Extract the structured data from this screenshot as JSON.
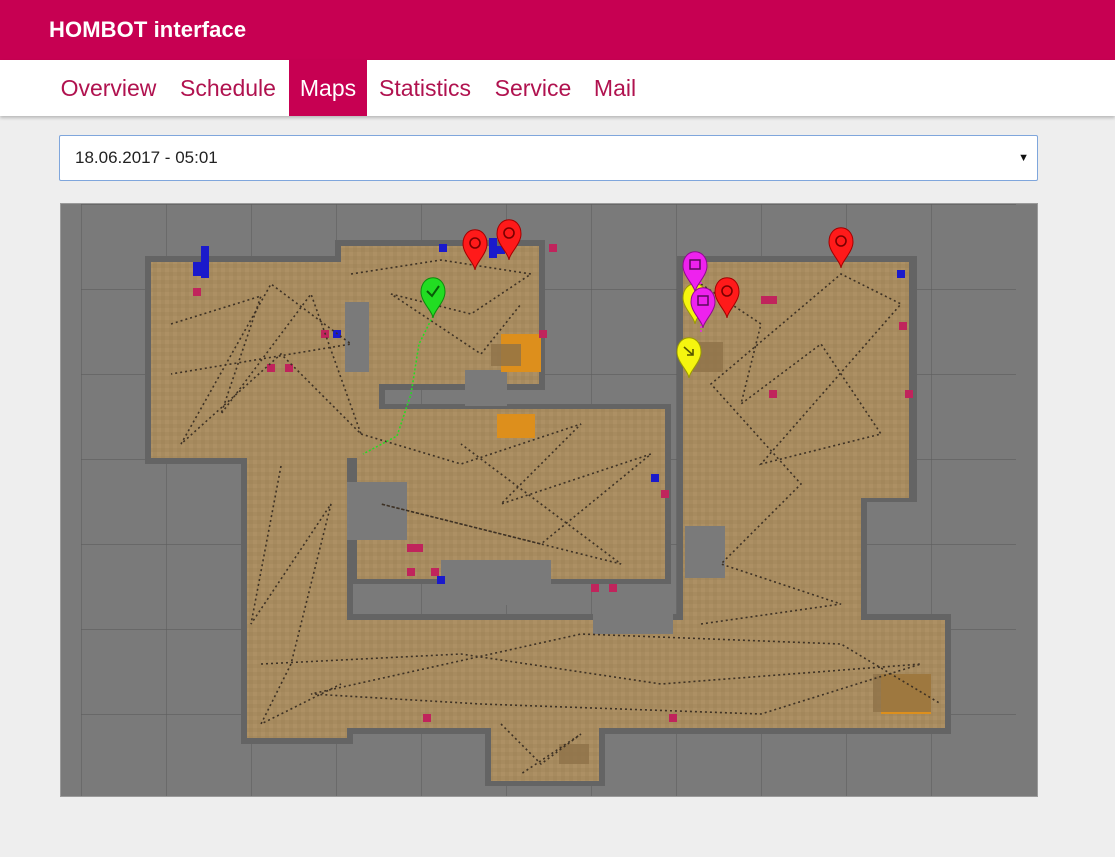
{
  "app": {
    "title": "HOMBOT interface"
  },
  "colors": {
    "brand": "#c70052",
    "floor": "#a78b5f",
    "wall": "#6a6a6a",
    "background": "#7a7a7a",
    "marker_red": "#ff1a1a",
    "marker_green": "#22dd22",
    "marker_magenta": "#ee22ee",
    "marker_yellow": "#f5f50f",
    "obstacle_blue": "#1a1acc",
    "obstacle_pink": "#c0245c",
    "carpet_orange": "#dd8f1c"
  },
  "nav": {
    "tabs": [
      {
        "label": "Overview",
        "active": false
      },
      {
        "label": "Schedule",
        "active": false
      },
      {
        "label": "Maps",
        "active": true
      },
      {
        "label": "Statistics",
        "active": false
      },
      {
        "label": "Service",
        "active": false
      },
      {
        "label": "Mail",
        "active": false
      }
    ]
  },
  "map_select": {
    "selected": "18.06.2017 - 05:01"
  },
  "map": {
    "markers": [
      {
        "type": "red",
        "icon": "power-icon"
      },
      {
        "type": "red",
        "icon": "power-icon"
      },
      {
        "type": "red",
        "icon": "power-icon"
      },
      {
        "type": "red",
        "icon": "power-icon"
      },
      {
        "type": "green",
        "icon": "check-icon"
      },
      {
        "type": "magenta",
        "icon": "home-icon"
      },
      {
        "type": "magenta",
        "icon": "home-icon"
      },
      {
        "type": "yellow",
        "icon": "arrow-icon"
      },
      {
        "type": "yellow",
        "icon": "arrow-icon"
      }
    ]
  }
}
